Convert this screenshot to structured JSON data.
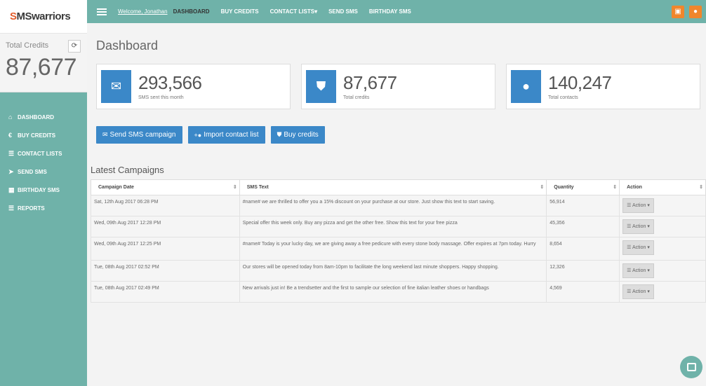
{
  "brand": {
    "prefix": "S",
    "name": "MSwarriors"
  },
  "credits": {
    "label": "Total Credits",
    "value": "87,677",
    "refresh_icon": "refresh-icon"
  },
  "sidebar": {
    "items": [
      {
        "label": "DASHBOARD",
        "icon": "dashboard-icon",
        "glyph": "⌂"
      },
      {
        "label": "BUY CREDITS",
        "icon": "euro-icon",
        "glyph": "€"
      },
      {
        "label": "CONTACT LISTS",
        "icon": "list-icon",
        "glyph": "☰"
      },
      {
        "label": "SEND SMS",
        "icon": "send-icon",
        "glyph": "➤"
      },
      {
        "label": "BIRTHDAY SMS",
        "icon": "calendar-icon",
        "glyph": "▦"
      },
      {
        "label": "REPORTS",
        "icon": "report-icon",
        "glyph": "☰"
      }
    ]
  },
  "topbar": {
    "welcome": "Welcome, Jonathan",
    "nav": [
      "DASHBOARD",
      "BUY CREDITS",
      "CONTACT LISTS",
      "SEND SMS",
      "BIRTHDAY SMS"
    ],
    "contact_lists_caret": "▾",
    "accent_color": "#f0862c"
  },
  "page_title": "Dashboard",
  "stats": [
    {
      "value": "293,566",
      "label": "SMS sent this month",
      "icon": "envelope-icon"
    },
    {
      "value": "87,677",
      "label": "Total credits",
      "icon": "shield-icon"
    },
    {
      "value": "140,247",
      "label": "Total contacts",
      "icon": "user-icon"
    }
  ],
  "buttons": {
    "send_sms": "Send SMS campaign",
    "import": "Import contact list",
    "buy": "Buy credits"
  },
  "section_title": "Latest Campaigns",
  "table": {
    "headers": [
      "Campaign Date",
      "SMS Text",
      "Quantity",
      "Action"
    ],
    "action_label": "Action",
    "rows": [
      {
        "date": "Sat, 12th Aug 2017 06:28 PM",
        "text": "#name# we are thrilled to offer you a 15% discount on your purchase at our store. Just show this text to start saving.",
        "qty": "56,914"
      },
      {
        "date": "Wed, 09th Aug 2017 12:28 PM",
        "text": "Special offer this week only. Buy any pizza and get the other free. Show this text for your free pizza",
        "qty": "45,356"
      },
      {
        "date": "Wed, 09th Aug 2017 12:25 PM",
        "text": "#name# Today is your lucky day, we are giving away a free pedicure with every stone body massage. Offer expires at 7pm today. Hurry",
        "qty": "8,654"
      },
      {
        "date": "Tue, 08th Aug 2017 02:52 PM",
        "text": "Our stores will be opened today from 8am-10pm to facilitate the long weekend last minute shoppers. Happy shopping.",
        "qty": "12,326"
      },
      {
        "date": "Tue, 08th Aug 2017 02:49 PM",
        "text": "New arrivals just in! Be a trendsetter and the first to sample our selection of fine italian leather shoes or handbags",
        "qty": "4,569"
      }
    ]
  },
  "colors": {
    "teal": "#6fb2a9",
    "blue": "#3b88c8",
    "orange": "#f0862c"
  }
}
